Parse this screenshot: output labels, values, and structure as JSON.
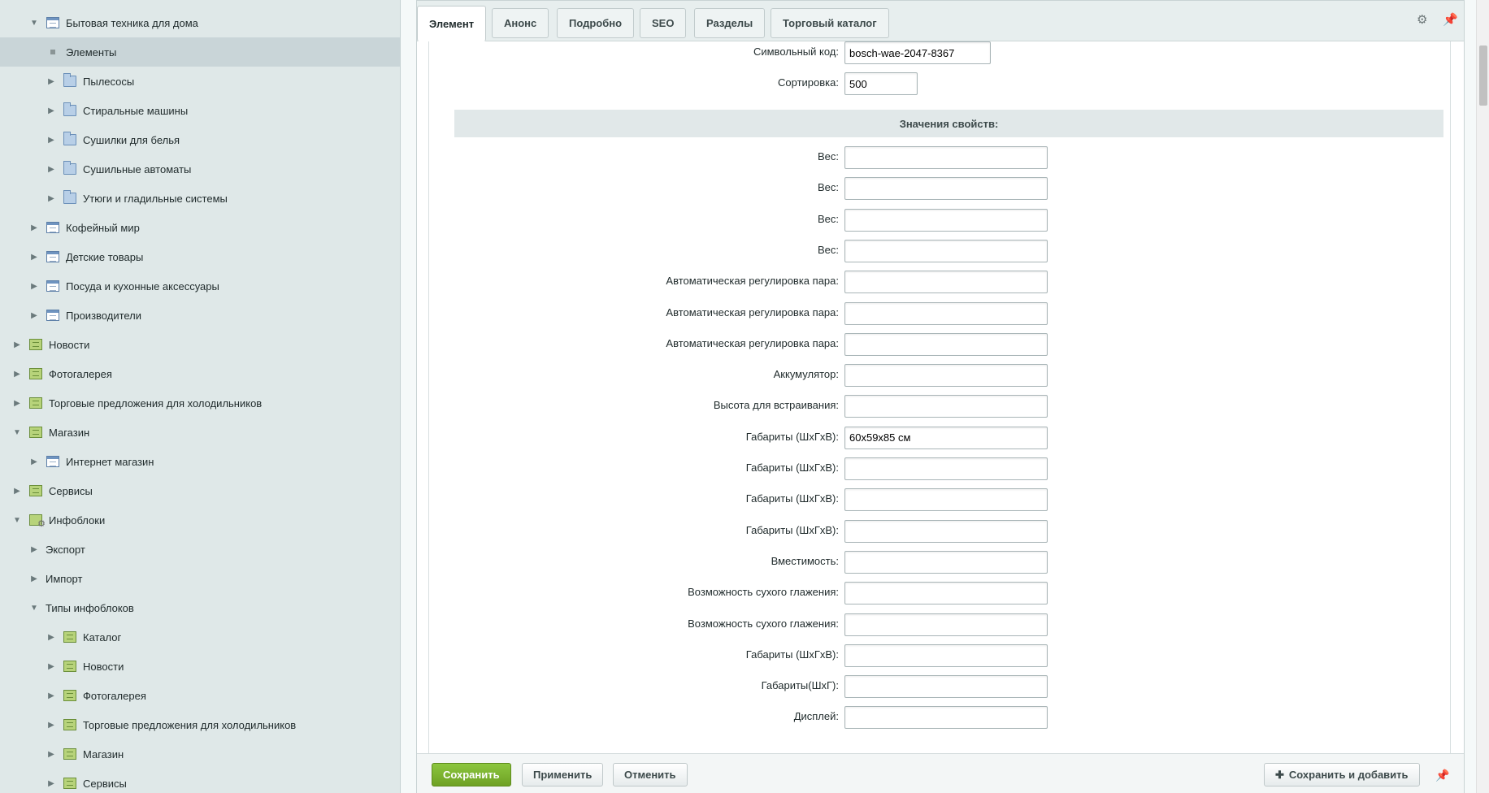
{
  "sidebar": {
    "items": [
      {
        "label": "Бытовая техника для дома",
        "arrow": "▼",
        "icon": "list-icon",
        "indent": 1,
        "selected": false
      },
      {
        "label": "Элементы",
        "arrow": "",
        "icon": "bullet-icon",
        "indent": 1,
        "selected": true
      },
      {
        "label": "Пылесосы",
        "arrow": "▶",
        "icon": "folder-icon",
        "indent": 2,
        "selected": false
      },
      {
        "label": "Стиральные машины",
        "arrow": "▶",
        "icon": "folder-icon",
        "indent": 2,
        "selected": false
      },
      {
        "label": "Сушилки для белья",
        "arrow": "▶",
        "icon": "folder-icon",
        "indent": 2,
        "selected": false
      },
      {
        "label": "Сушильные автоматы",
        "arrow": "▶",
        "icon": "folder-icon",
        "indent": 2,
        "selected": false
      },
      {
        "label": "Утюги и гладильные системы",
        "arrow": "▶",
        "icon": "folder-icon",
        "indent": 2,
        "selected": false
      },
      {
        "label": "Кофейный мир",
        "arrow": "▶",
        "icon": "list-icon",
        "indent": 1,
        "selected": false
      },
      {
        "label": "Детские товары",
        "arrow": "▶",
        "icon": "list-icon",
        "indent": 1,
        "selected": false
      },
      {
        "label": "Посуда и кухонные аксессуары",
        "arrow": "▶",
        "icon": "list-icon",
        "indent": 1,
        "selected": false
      },
      {
        "label": "Производители",
        "arrow": "▶",
        "icon": "list-icon",
        "indent": 1,
        "selected": false
      },
      {
        "label": "Новости",
        "arrow": "▶",
        "icon": "module-icon",
        "indent": 0,
        "selected": false
      },
      {
        "label": "Фотогалерея",
        "arrow": "▶",
        "icon": "module-icon",
        "indent": 0,
        "selected": false
      },
      {
        "label": "Торговые предложения для холодильников",
        "arrow": "▶",
        "icon": "module-icon",
        "indent": 0,
        "selected": false
      },
      {
        "label": "Магазин",
        "arrow": "▼",
        "icon": "module-icon",
        "indent": 0,
        "selected": false
      },
      {
        "label": "Интернет магазин",
        "arrow": "▶",
        "icon": "list-icon",
        "indent": 1,
        "selected": false
      },
      {
        "label": "Сервисы",
        "arrow": "▶",
        "icon": "module-icon",
        "indent": 0,
        "selected": false
      },
      {
        "label": "Инфоблоки",
        "arrow": "▼",
        "icon": "module-settings-icon",
        "indent": 0,
        "selected": false
      },
      {
        "label": "Экспорт",
        "arrow": "▶",
        "icon": "",
        "indent": 1,
        "selected": false
      },
      {
        "label": "Импорт",
        "arrow": "▶",
        "icon": "",
        "indent": 1,
        "selected": false
      },
      {
        "label": "Типы инфоблоков",
        "arrow": "▼",
        "icon": "",
        "indent": 1,
        "selected": false
      },
      {
        "label": "Каталог",
        "arrow": "▶",
        "icon": "module-icon",
        "indent": 2,
        "selected": false
      },
      {
        "label": "Новости",
        "arrow": "▶",
        "icon": "module-icon",
        "indent": 2,
        "selected": false
      },
      {
        "label": "Фотогалерея",
        "arrow": "▶",
        "icon": "module-icon",
        "indent": 2,
        "selected": false
      },
      {
        "label": "Торговые предложения для холодильников",
        "arrow": "▶",
        "icon": "module-icon",
        "indent": 2,
        "selected": false
      },
      {
        "label": "Магазин",
        "arrow": "▶",
        "icon": "module-icon",
        "indent": 2,
        "selected": false
      },
      {
        "label": "Сервисы",
        "arrow": "▶",
        "icon": "module-icon",
        "indent": 2,
        "selected": false
      }
    ]
  },
  "tabs": [
    {
      "label": "Элемент",
      "active": true
    },
    {
      "label": "Анонс",
      "active": false
    },
    {
      "label": "Подробно",
      "active": false
    },
    {
      "label": "SEO",
      "active": false
    },
    {
      "label": "Разделы",
      "active": false
    },
    {
      "label": "Торговый каталог",
      "active": false
    }
  ],
  "tab_tools": {
    "settings_icon": "gear-icon",
    "pin_icon": "pin-icon"
  },
  "form": {
    "top_fields": [
      {
        "label": "Символьный код:",
        "value": "bosch-wae-2047-8367",
        "size": "medium"
      },
      {
        "label": "Сортировка:",
        "value": "500",
        "size": "short"
      }
    ],
    "props_header": "Значения свойств:",
    "properties": [
      {
        "label": "Вес:",
        "value": ""
      },
      {
        "label": "Вес:",
        "value": ""
      },
      {
        "label": "Вес:",
        "value": ""
      },
      {
        "label": "Вес:",
        "value": ""
      },
      {
        "label": "Автоматическая регулировка пара:",
        "value": ""
      },
      {
        "label": "Автоматическая регулировка пара:",
        "value": ""
      },
      {
        "label": "Автоматическая регулировка пара:",
        "value": ""
      },
      {
        "label": "Аккумулятор:",
        "value": ""
      },
      {
        "label": "Высота для встраивания:",
        "value": ""
      },
      {
        "label": "Габариты (ШхГхВ):",
        "value": "60x59x85 см"
      },
      {
        "label": "Габариты (ШхГхВ):",
        "value": ""
      },
      {
        "label": "Габариты (ШхГхВ):",
        "value": ""
      },
      {
        "label": "Габариты (ШхГхВ):",
        "value": ""
      },
      {
        "label": "Вместимость:",
        "value": ""
      },
      {
        "label": "Возможность сухого глажения:",
        "value": ""
      },
      {
        "label": "Возможность сухого глажения:",
        "value": ""
      },
      {
        "label": "Габариты (ШхГхВ):",
        "value": ""
      },
      {
        "label": "Габариты(ШхГ):",
        "value": ""
      },
      {
        "label": "Дисплей:",
        "value": ""
      }
    ]
  },
  "bottombar": {
    "save_label": "Сохранить",
    "apply_label": "Применить",
    "cancel_label": "Отменить",
    "save_add_label": "Сохранить и добавить",
    "save_add_icon": "plus-icon",
    "pin_icon": "pin-icon"
  },
  "colors": {
    "sidebar_bg": "#dfe8e8",
    "selected_row": "#c9d5d8",
    "save_button": "#7cb32f",
    "props_header_bg": "#e1e8e9"
  }
}
